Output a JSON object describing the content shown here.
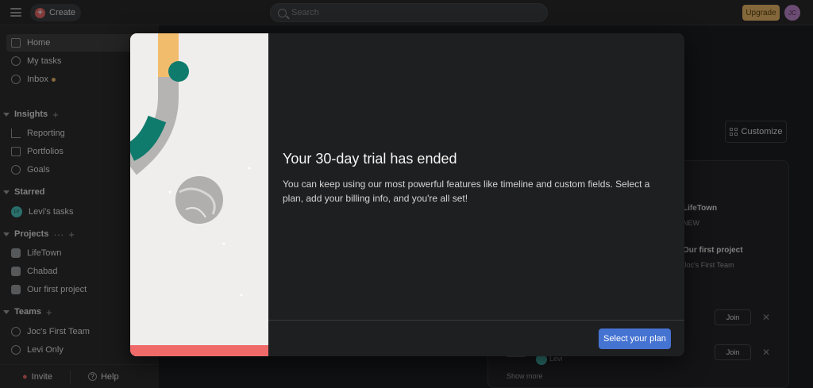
{
  "topbar": {
    "create_label": "Create",
    "search_placeholder": "Search",
    "upgrade_label": "Upgrade",
    "avatar_initials": "JC"
  },
  "sidebar": {
    "items": [
      {
        "label": "Home"
      },
      {
        "label": "My tasks"
      },
      {
        "label": "Inbox"
      }
    ],
    "insights": {
      "title": "Insights",
      "items": [
        {
          "label": "Reporting"
        },
        {
          "label": "Portfolios"
        },
        {
          "label": "Goals"
        }
      ]
    },
    "starred": {
      "title": "Starred",
      "items": [
        {
          "label": "Levi's tasks",
          "avatar": "LV"
        }
      ]
    },
    "projects": {
      "title": "Projects",
      "items": [
        {
          "label": "LifeTown"
        },
        {
          "label": "Chabad"
        },
        {
          "label": "Our first project"
        }
      ]
    },
    "teams": {
      "title": "Teams",
      "items": [
        {
          "label": "Joc's First Team"
        },
        {
          "label": "Levi Only"
        }
      ]
    },
    "footer": {
      "invite_label": "Invite",
      "help_label": "Help"
    }
  },
  "main": {
    "customize_label": "Customize",
    "card": {
      "project1_name": "LifeTown",
      "project1_sub": "NEW",
      "project2_name": "Our first project",
      "project2_sub": "Joc's First Team",
      "join_label": "Join",
      "person_name": "Levi",
      "show_more": "Show more"
    }
  },
  "modal": {
    "title": "Your 30-day trial has ended",
    "body": "You can keep using our most powerful features like timeline and custom fields. Select a plan, add your billing info, and you're all set!",
    "cta_label": "Select your plan"
  },
  "colors": {
    "accent_blue": "#4573d2",
    "coral": "#f06a6a",
    "green": "#0f7b6c",
    "yellow": "#f1bd6c"
  }
}
